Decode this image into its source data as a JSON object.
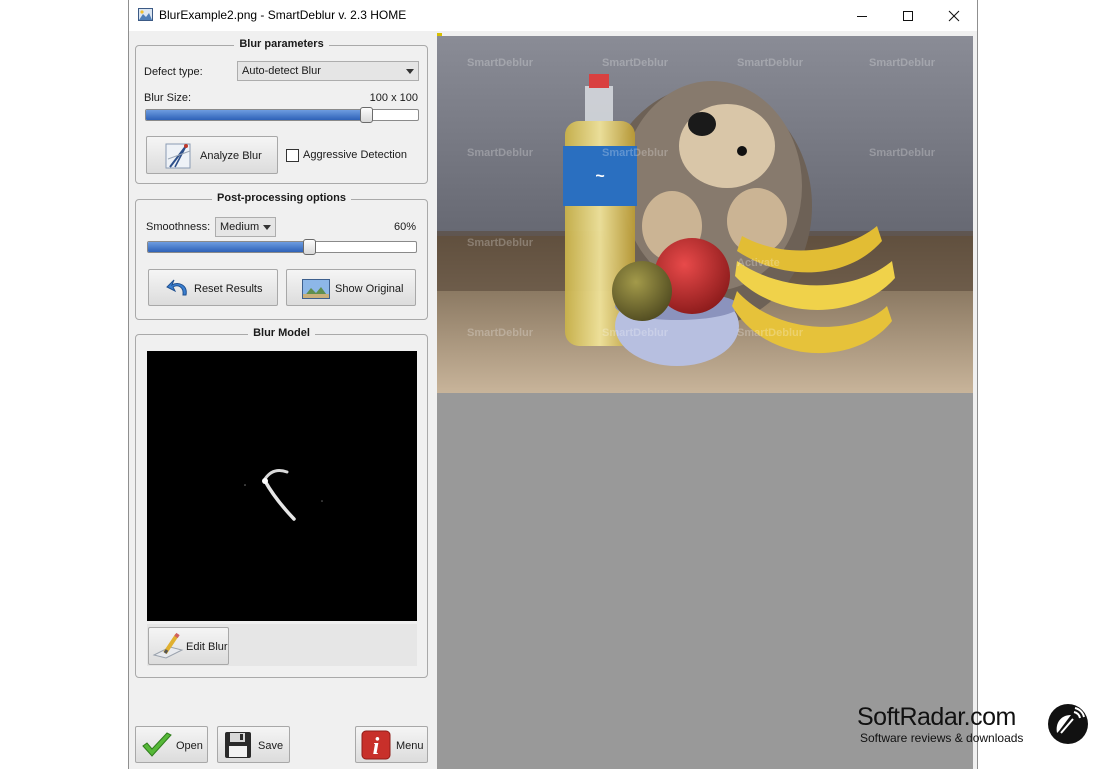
{
  "window": {
    "title": "BlurExample2.png - SmartDeblur v. 2.3 HOME",
    "controls": [
      "minimize-icon",
      "maximize-icon",
      "close-icon"
    ]
  },
  "blur_parameters": {
    "title": "Blur parameters",
    "defect_type_label": "Defect type:",
    "defect_type_value": "Auto-detect Blur",
    "blur_size_label": "Blur Size:",
    "blur_size_value": "100 x 100",
    "blur_size_level": 0.81,
    "analyze_button": "Analyze Blur",
    "aggressive_label": "Aggressive Detection",
    "aggressive_checked": false
  },
  "post_processing": {
    "title": "Post-processing options",
    "smoothness_label": "Smoothness:",
    "smoothness_value": "Medium",
    "smoothness_percent": "60%",
    "smoothness_level": 0.6,
    "reset_button": "Reset Results",
    "show_original_button": "Show Original"
  },
  "blur_model": {
    "title": "Blur Model",
    "edit_button": "Edit Blur"
  },
  "bottom_bar": {
    "open_button": "Open",
    "save_button": "Save",
    "menu_button": "Menu"
  },
  "watermark": {
    "brand": "SoftRadar.com",
    "tagline": "Software reviews & downloads"
  },
  "colors": {
    "window_bg": "#f0f0f0",
    "slider_fill": "#2e62b8",
    "image_bg": "#999999",
    "menu_red": "#c8302a"
  }
}
